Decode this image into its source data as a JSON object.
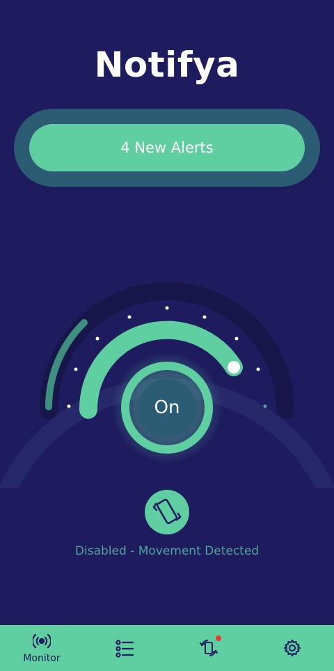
{
  "app": {
    "title": "Notifya"
  },
  "alerts": {
    "button_label": "4 New Alerts"
  },
  "gauge": {
    "state_label": "On"
  },
  "status": {
    "icon": "vibration-phone-icon",
    "text": "Disabled - Movement Detected"
  },
  "nav": {
    "items": [
      {
        "label": "Monitor",
        "icon": "broadcast-icon",
        "active": true
      },
      {
        "label": "",
        "icon": "list-icon",
        "active": false
      },
      {
        "label": "",
        "icon": "phone-sync-icon",
        "active": false,
        "badge": true
      },
      {
        "label": "",
        "icon": "gear-icon",
        "active": false
      }
    ]
  },
  "colors": {
    "background": "#1e1b5f",
    "accent": "#5fcea0",
    "alert_ring": "#2b5c74",
    "badge": "#e53935"
  }
}
